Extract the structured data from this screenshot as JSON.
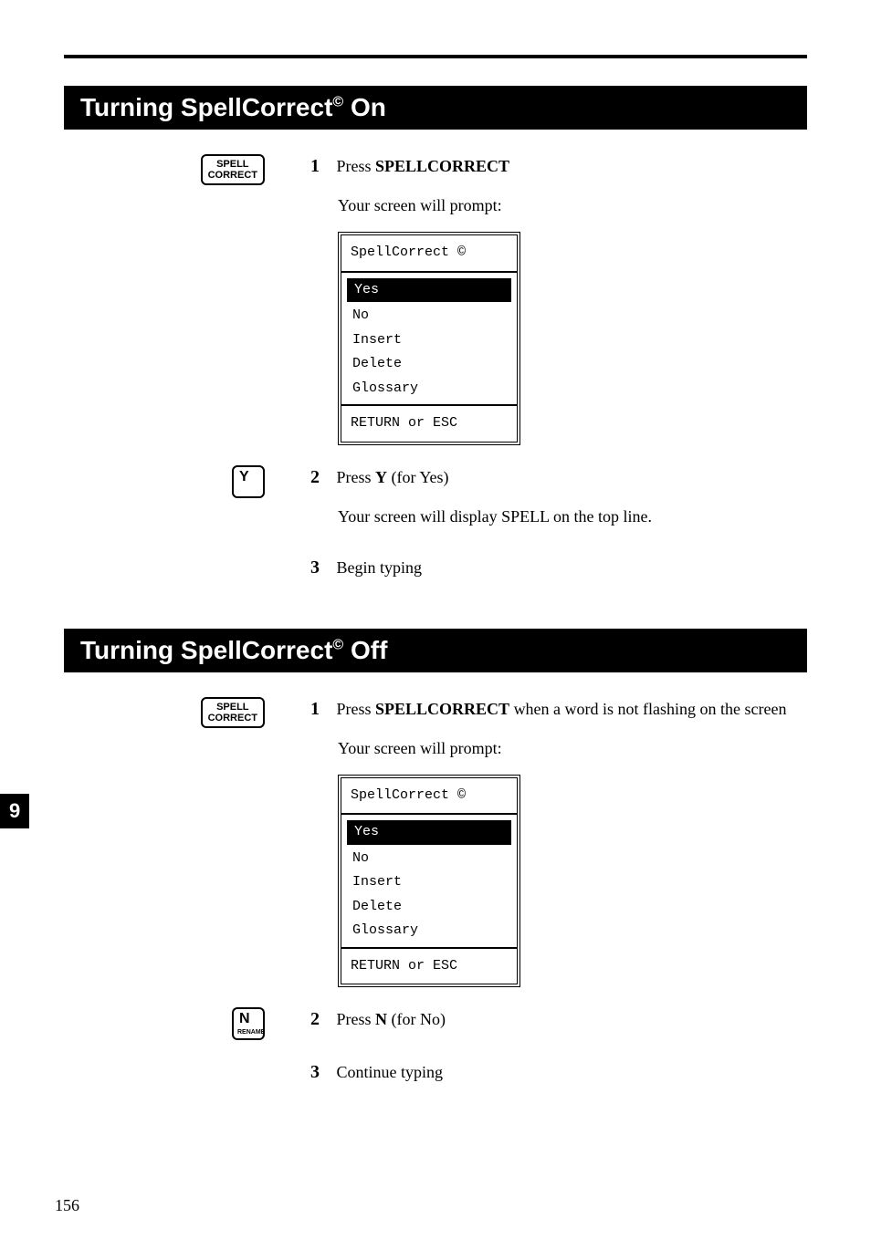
{
  "sideTab": "9",
  "pageNumber": "156",
  "sections": [
    {
      "heading": {
        "pre": "Turning SpellCorrect",
        "sup": "©",
        "post": " On"
      },
      "steps": [
        {
          "num": "1",
          "keycap": {
            "lines": [
              "SPELL",
              "CORRECT"
            ],
            "type": "small"
          },
          "text": {
            "pre": "Press ",
            "bold": "SPELLCORRECT",
            "post": ""
          },
          "after": "Your screen will prompt:",
          "screen": {
            "title": "SpellCorrect ©",
            "options": [
              "Yes",
              "No",
              "Insert",
              "Delete",
              "Glossary"
            ],
            "selected": 0,
            "footer": "RETURN or ESC"
          }
        },
        {
          "num": "2",
          "keycap": {
            "lines": [
              "Y"
            ],
            "type": "large"
          },
          "text": {
            "pre": "Press ",
            "bold": "Y",
            "post": " (for Yes)"
          },
          "after": "Your screen will display SPELL on the top line."
        },
        {
          "num": "3",
          "text": {
            "pre": "Begin typing",
            "bold": "",
            "post": ""
          }
        }
      ]
    },
    {
      "heading": {
        "pre": "Turning SpellCorrect",
        "sup": "©",
        "post": " Off"
      },
      "steps": [
        {
          "num": "1",
          "keycap": {
            "lines": [
              "SPELL",
              "CORRECT"
            ],
            "type": "small"
          },
          "text": {
            "pre": "Press ",
            "bold": "SPELLCORRECT",
            "post": " when a word is not flashing on the screen"
          },
          "after": "Your screen will prompt:",
          "screen": {
            "title": "SpellCorrect ©",
            "options": [
              "Yes",
              "No",
              "Insert",
              "Delete",
              "Glossary"
            ],
            "selected": 0,
            "footer": "RETURN or ESC"
          }
        },
        {
          "num": "2",
          "keycap": {
            "lines": [
              "N"
            ],
            "type": "large",
            "sub": "RENAME"
          },
          "text": {
            "pre": "Press ",
            "bold": "N",
            "post": " (for No)"
          }
        },
        {
          "num": "3",
          "text": {
            "pre": "Continue typing",
            "bold": "",
            "post": ""
          }
        }
      ]
    }
  ]
}
